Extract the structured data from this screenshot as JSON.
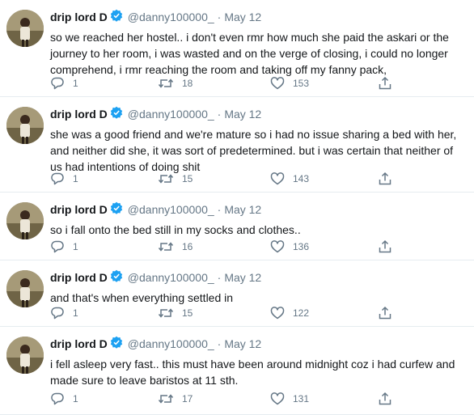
{
  "colors": {
    "verified": "#1da1f2",
    "secondary": "#657786",
    "text": "#14171a"
  },
  "tweets": [
    {
      "name": "drip lord D",
      "handle": "@danny100000_",
      "date": "May 12",
      "text": "so we reached her hostel.. i don't even rmr how much she paid the askari or the journey to her room, i was wasted and on the verge of closing, i could no longer comprehend, i rmr reaching the room and taking off my fanny pack,",
      "replies": "1",
      "retweets": "18",
      "likes": "153"
    },
    {
      "name": "drip lord D",
      "handle": "@danny100000_",
      "date": "May 12",
      "text": "she was a good friend and we're mature so i had no issue sharing a bed with her, and neither did she, it was sort of predetermined. but i was certain that neither of us had intentions of doing shit",
      "replies": "1",
      "retweets": "15",
      "likes": "143"
    },
    {
      "name": "drip lord D",
      "handle": "@danny100000_",
      "date": "May 12",
      "text": "so i fall onto the bed still in my socks and clothes..",
      "replies": "1",
      "retweets": "16",
      "likes": "136"
    },
    {
      "name": "drip lord D",
      "handle": "@danny100000_",
      "date": "May 12",
      "text": "and that's when everything settled in",
      "replies": "1",
      "retweets": "15",
      "likes": "122"
    },
    {
      "name": "drip lord D",
      "handle": "@danny100000_",
      "date": "May 12",
      "text": "i fell asleep very fast.. this must have been around midnight coz i had curfew and made sure to leave baristos at 11 sth.",
      "replies": "1",
      "retweets": "17",
      "likes": "131"
    }
  ],
  "icons": {
    "reply": "reply-icon",
    "retweet": "retweet-icon",
    "like": "like-icon",
    "share": "share-icon",
    "verified": "verified-badge-icon"
  }
}
